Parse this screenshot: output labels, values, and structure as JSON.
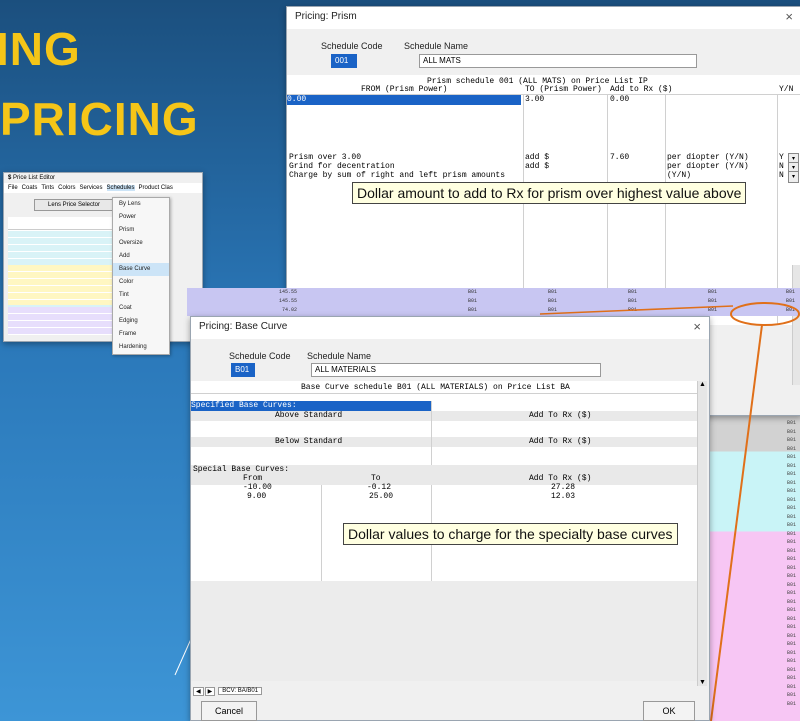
{
  "slide": {
    "title_line1": "ING",
    "title_line2": "PRICING"
  },
  "prism": {
    "title": "Pricing: Prism",
    "close": "×",
    "schedule_code_label": "Schedule Code",
    "schedule_name_label": "Schedule Name",
    "schedule_code": "001",
    "schedule_name": "ALL MATS",
    "heading": "Prism schedule 001 (ALL MATS) on Price List IP",
    "col_from": "FROM (Prism Power)",
    "col_to": "TO (Prism Power)",
    "col_add": "Add to Rx ($)",
    "col_yn": "Y/N",
    "row1_from": "0.00",
    "row1_to": "3.00",
    "row1_add": "0.00",
    "over_label": "Prism over 3.00",
    "over_add": "add $",
    "over_value": "7.60",
    "over_per": "per diopter (Y/N)",
    "over_yn": "Y",
    "grind_label": "Grind for decentration",
    "grind_add": "add $",
    "grind_per": "per diopter (Y/N)",
    "grind_yn": "N",
    "charge_label": "Charge by sum of right and left prism amounts",
    "charge_per": "(Y/N)",
    "charge_yn": "N",
    "callout": "Dollar amount to add to Rx for prism over highest value above"
  },
  "editor": {
    "title": "Price List Editor",
    "menu": [
      "File",
      "Coats",
      "Tints",
      "Colors",
      "Services",
      "Schedules",
      "Product Clas"
    ],
    "lens_selector": "Lens Price Selector",
    "schedules_menu": [
      "By Lens",
      "Power",
      "Prism",
      "Oversize",
      "Add",
      "Base Curve",
      "Color",
      "Tint",
      "Coat",
      "Edging",
      "Frame",
      "Hardening"
    ],
    "selected_item": "Base Curve"
  },
  "strip": {
    "rows": [
      {
        "c1": "145.55",
        "c2": "B01",
        "c3": "B01",
        "c4": "B01",
        "c5": "B01",
        "c6": "B01"
      },
      {
        "c1": "145.55",
        "c2": "B01",
        "c3": "B01",
        "c4": "B01",
        "c5": "B01",
        "c6": "B01"
      },
      {
        "c1": "74.02",
        "c2": "B01",
        "c3": "B01",
        "c4": "B01",
        "c5": "B01",
        "c6": "B01"
      }
    ],
    "side_code": "B01"
  },
  "basecurve": {
    "title": "Pricing: Base Curve",
    "close": "×",
    "schedule_code_label": "Schedule Code",
    "schedule_name_label": "Schedule Name",
    "schedule_code": "B01",
    "schedule_name": "ALL MATERIALS",
    "heading": "Base Curve schedule B01 (ALL MATERIALS) on Price List BA",
    "specified_label": "Specified Base Curves:",
    "above": "Above Standard",
    "below": "Below Standard",
    "add_to_rx": "Add To Rx ($)",
    "special_label": "Special Base Curves:",
    "col_from": "From",
    "col_to": "To",
    "col_add": "Add To Rx ($)",
    "special_rows": [
      {
        "from": "-10.00",
        "to": "-0.12",
        "add": "27.28"
      },
      {
        "from": "9.00",
        "to": "25.00",
        "add": "12.03"
      }
    ],
    "callout": "Dollar values to charge for the specialty base curves",
    "tab": "BCV: BA/B01",
    "cancel": "Cancel",
    "ok": "OK"
  }
}
